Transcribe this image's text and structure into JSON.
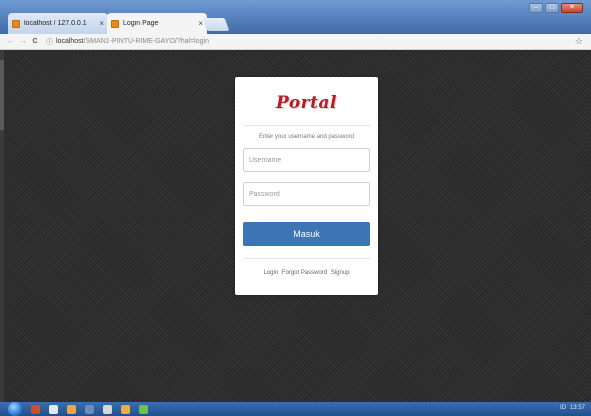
{
  "browser": {
    "tabs": [
      {
        "label": "localhost / 127.0.0.1",
        "active": false
      },
      {
        "label": "Login Page",
        "active": true
      }
    ],
    "tab_close": "×",
    "window_controls": {
      "minimize": "–",
      "maximize": "□",
      "close": "✕"
    },
    "nav": {
      "back": "←",
      "forward": "→",
      "reload": "C",
      "info": "ⓘ"
    },
    "url": {
      "host": "localhost",
      "path": "/SMAN1-PINTU-RIME-GAYO/?hal=login"
    },
    "bookmark_star": "☆"
  },
  "login": {
    "logo_text": "Portal",
    "subtitle": "Enter your username and password",
    "username_placeholder": "Username",
    "password_placeholder": "Password",
    "submit_label": "Masuk",
    "links": {
      "login": "Login",
      "forgot": "Forgot Password",
      "signup": "Signup"
    }
  },
  "taskbar": {
    "tray_text": "ID",
    "clock": "13:57"
  },
  "colors": {
    "page_background": "#2e2e2e",
    "submit_button": "#3c74b5",
    "logo": "#b01d2c"
  }
}
